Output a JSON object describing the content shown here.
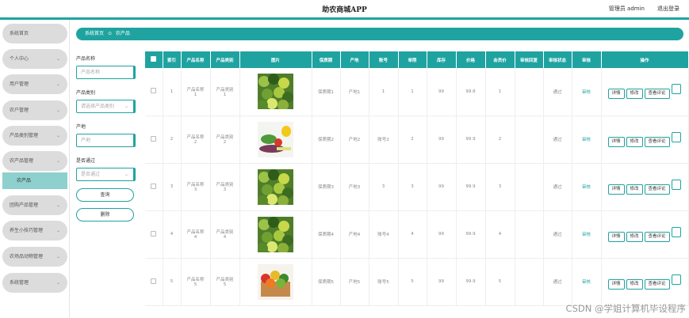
{
  "header": {
    "title": "助农商城APP",
    "admin_label": "管理员 admin",
    "logout_label": "退出登录"
  },
  "sidebar": {
    "items": [
      {
        "label": "系统首页",
        "chevron": false
      },
      {
        "label": "个人中心",
        "chevron": true
      },
      {
        "label": "用户管理",
        "chevron": true
      },
      {
        "label": "农户管理",
        "chevron": true
      },
      {
        "label": "产品类别管理",
        "chevron": true
      },
      {
        "label": "农产品管理",
        "chevron": true
      },
      {
        "label": "团购产品管理",
        "chevron": true
      },
      {
        "label": "养生小技巧管理",
        "chevron": true
      },
      {
        "label": "农场品动物管理",
        "chevron": true
      },
      {
        "label": "系统管理",
        "chevron": true
      }
    ],
    "active_sub": "农产品",
    "chevron_glyph": "⌄"
  },
  "breadcrumb": {
    "home": "系统首页",
    "sep": "⊙",
    "current": "农产品"
  },
  "filters": {
    "name_label": "产品名称",
    "name_placeholder": "产品名称",
    "category_label": "产品类别",
    "category_placeholder": "请选择产品类别",
    "origin_label": "产地",
    "origin_placeholder": "产地",
    "pass_label": "是否通过",
    "pass_placeholder": "是否通过",
    "search_label": "查询",
    "delete_label": "删除"
  },
  "table": {
    "columns": [
      "索引",
      "产品名称",
      "产品类别",
      "图片",
      "保质期",
      "产地",
      "账号",
      "单限",
      "库存",
      "价格",
      "会员价",
      "审核回复",
      "审核状态",
      "审核",
      "操作"
    ],
    "rows": [
      {
        "index": "1",
        "name": "产品名称\n1",
        "category": "产品类别\n1",
        "image": "green-vegetables",
        "shelf": "保质期1",
        "origin": "产地1",
        "account": "1",
        "limit": "1",
        "stock": "99",
        "price": "99.8",
        "member_price": "1",
        "reply": "",
        "status": "通过",
        "audit": "审核"
      },
      {
        "index": "2",
        "name": "产品名称\n2",
        "category": "产品类别\n2",
        "image": "mixed-vegetables",
        "shelf": "保质期2",
        "origin": "产地2",
        "account": "账号2",
        "limit": "2",
        "stock": "99",
        "price": "99.9",
        "member_price": "2",
        "reply": "",
        "status": "通过",
        "audit": "审核"
      },
      {
        "index": "3",
        "name": "产品名称\n3",
        "category": "产品类别\n3",
        "image": "green-vegetables",
        "shelf": "保质期3",
        "origin": "产地3",
        "account": "3",
        "limit": "3",
        "stock": "99",
        "price": "99.9",
        "member_price": "3",
        "reply": "",
        "status": "通过",
        "audit": "审核"
      },
      {
        "index": "4",
        "name": "产品名称\n4",
        "category": "产品类别\n4",
        "image": "green-vegetables",
        "shelf": "保质期4",
        "origin": "产地4",
        "account": "账号4",
        "limit": "4",
        "stock": "99",
        "price": "99.9",
        "member_price": "4",
        "reply": "",
        "status": "通过",
        "audit": "审核"
      },
      {
        "index": "5",
        "name": "产品名称\n5",
        "category": "产品类别\n5",
        "image": "vegetable-basket",
        "shelf": "保质期5",
        "origin": "产地5",
        "account": "账号5",
        "limit": "5",
        "stock": "99",
        "price": "99.9",
        "member_price": "5",
        "reply": "",
        "status": "通过",
        "audit": "审核"
      }
    ],
    "actions": [
      "详情",
      "修改",
      "查看评论"
    ]
  },
  "watermark": "CSDN @学姐计算机毕设程序",
  "colors": {
    "accent": "#1fa3a0",
    "sidebar_item": "#dcdcdc",
    "sidebar_active": "#8ed0cd"
  }
}
